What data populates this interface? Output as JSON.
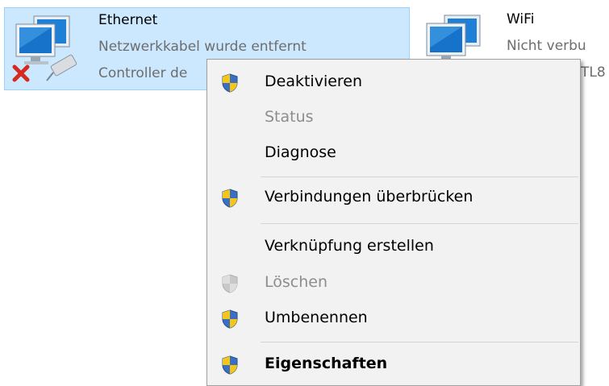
{
  "adapters": [
    {
      "name": "Ethernet",
      "status": "Netzwerkkabel wurde entfernt",
      "device": "Controller de",
      "selected": true
    },
    {
      "name": "WiFi",
      "status": "Nicht verbu",
      "device": "TL8",
      "selected": false
    }
  ],
  "context_menu": {
    "items": [
      {
        "label": "Deaktivieren",
        "shield": "shield-icon",
        "enabled": true,
        "bold": false
      },
      {
        "label": "Status",
        "shield": null,
        "enabled": false,
        "bold": false
      },
      {
        "label": "Diagnose",
        "shield": null,
        "enabled": true,
        "bold": false
      },
      {
        "label": "Verbindungen überbrücken",
        "shield": "shield-icon",
        "enabled": true,
        "bold": false
      },
      {
        "label": "Verknüpfung erstellen",
        "shield": null,
        "enabled": true,
        "bold": false
      },
      {
        "label": "Löschen",
        "shield": "shield-icon",
        "enabled": false,
        "bold": false
      },
      {
        "label": "Umbenennen",
        "shield": "shield-icon",
        "enabled": true,
        "bold": false
      },
      {
        "label": "Eigenschaften",
        "shield": "shield-icon",
        "enabled": true,
        "bold": true
      }
    ]
  },
  "colors": {
    "selection_bg": "#cce8ff",
    "selection_border": "#99d1ff",
    "menu_bg": "#f2f2f2",
    "disabled_text": "#8d8d8d",
    "error_x": "#d42a1f",
    "connection_green": "#2e9c3a"
  }
}
